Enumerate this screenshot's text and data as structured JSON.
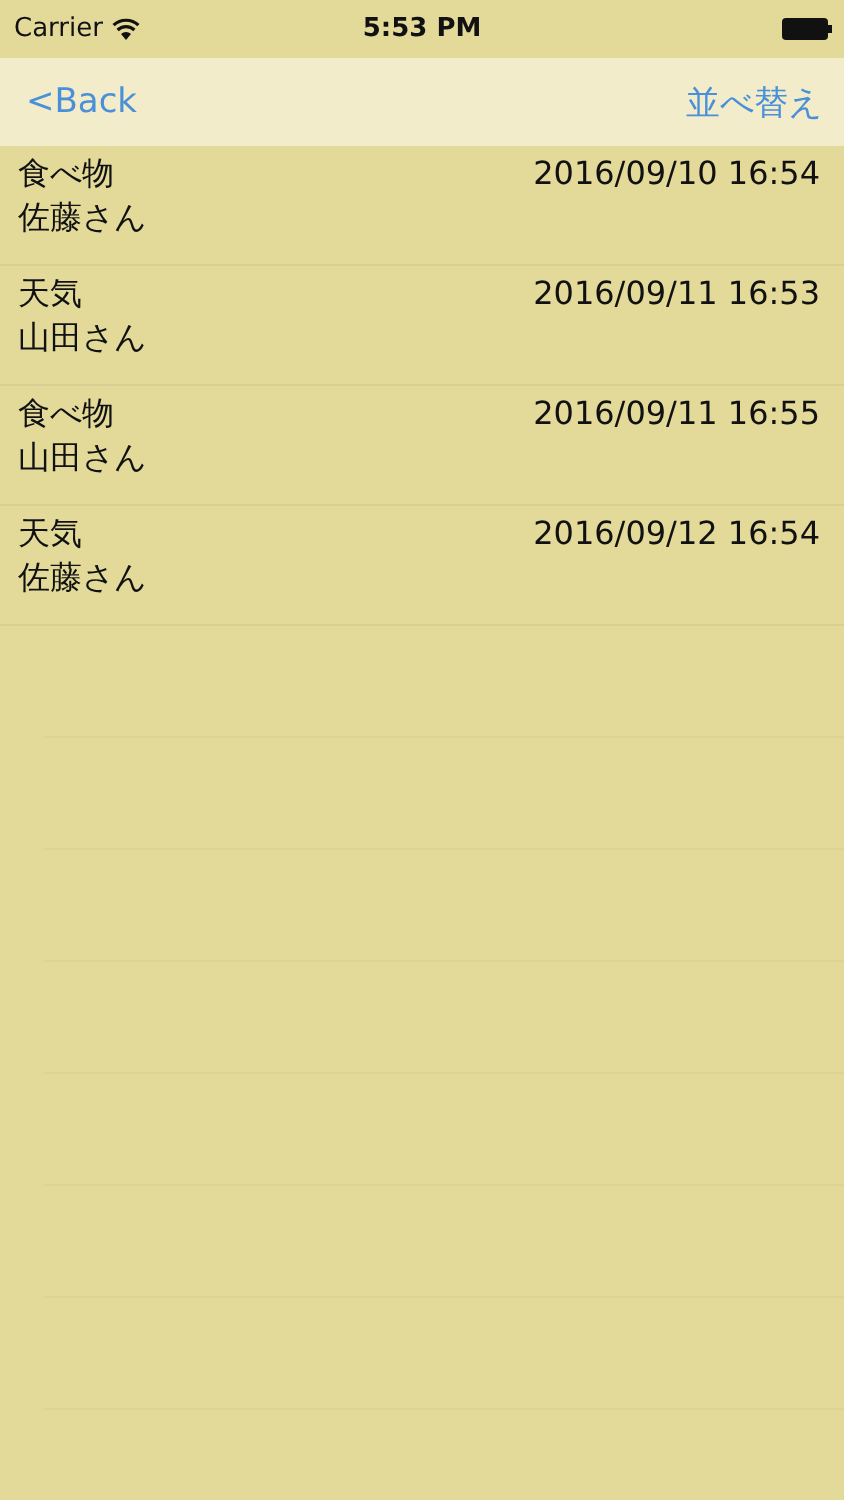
{
  "status_bar": {
    "carrier": "Carrier",
    "time": "5:53 PM"
  },
  "nav_bar": {
    "back": "<Back",
    "action": "並べ替え"
  },
  "rows": [
    {
      "title": "食べ物",
      "date": "2016/09/10 16:54",
      "name": "佐藤さん"
    },
    {
      "title": "天気",
      "date": "2016/09/11 16:53",
      "name": "山田さん"
    },
    {
      "title": "食べ物",
      "date": "2016/09/11 16:55",
      "name": "山田さん"
    },
    {
      "title": "天気",
      "date": "2016/09/12 16:54",
      "name": "佐藤さん"
    }
  ]
}
